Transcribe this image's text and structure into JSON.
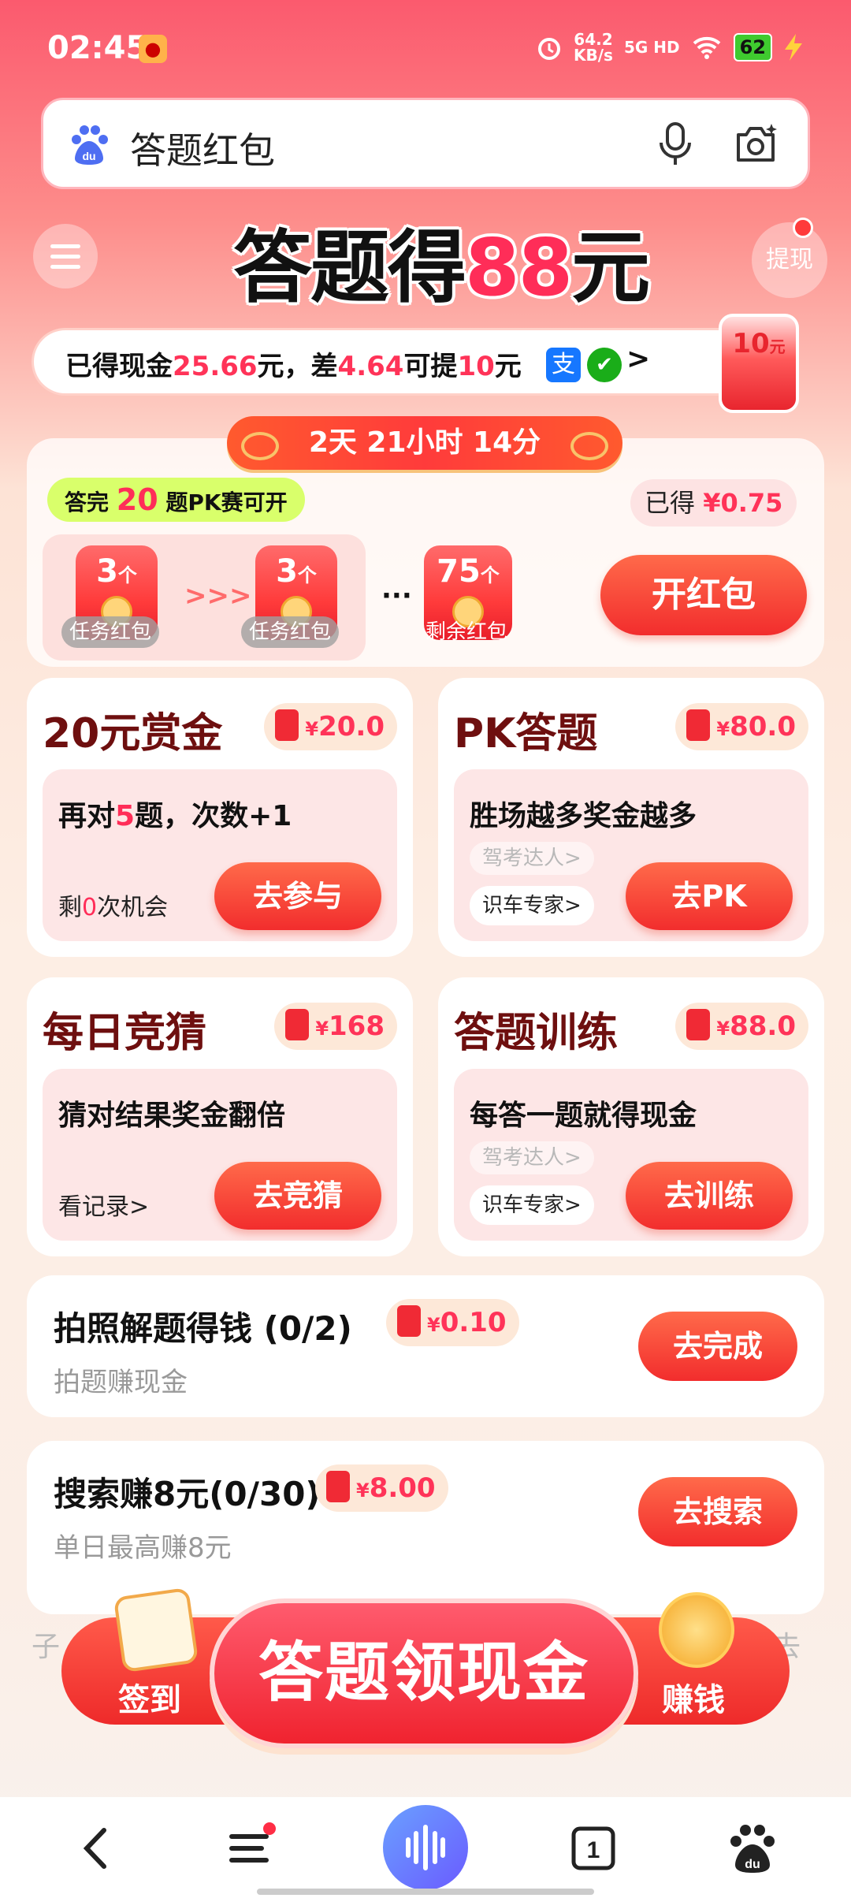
{
  "status": {
    "time": "02:45",
    "speed_value": "64.2",
    "speed_unit": "KB/s",
    "network": "5G HD",
    "battery": "62"
  },
  "search": {
    "query": "答题红包"
  },
  "header": {
    "headline_pre": "答题得",
    "headline_num": "88",
    "headline_post": "元",
    "withdraw": "提现"
  },
  "cash": {
    "t1": "已得现金",
    "v1": "25.66",
    "t2": "元，差",
    "v2": "4.64",
    "t3": "可提",
    "v3": "10",
    "t4": "元",
    "alipay": "支",
    "arrow": ">",
    "env_amount": "10",
    "env_unit": "元"
  },
  "countdown": "2天 21小时 14分",
  "pk_card": {
    "tag_pre": "答完",
    "tag_num": "20",
    "tag_post": "题PK赛可开",
    "earned_label": "已得",
    "earned_value": "¥0.75",
    "envelopes": [
      {
        "count": "3",
        "unit": "个",
        "label": "任务红包"
      },
      {
        "count": "3",
        "unit": "个",
        "label": "任务红包"
      },
      {
        "count": "75",
        "unit": "个",
        "label": "剩余红包"
      }
    ],
    "chev": ">>>",
    "dots": "···",
    "open_btn": "开红包"
  },
  "cards": [
    {
      "title": "20元赏金",
      "reward_y": "¥",
      "reward": "20.0",
      "desc_pre": "再对",
      "desc_num": "5",
      "desc_post": "题，次数+1",
      "sub_pre": "剩",
      "sub_num": "0",
      "sub_post": "次机会",
      "btn": "去参与"
    },
    {
      "title": "PK答题",
      "reward_y": "¥",
      "reward": "80.0",
      "desc": "胜场越多奖金越多",
      "ghost": "驾考达人>",
      "pill": "识车专家>",
      "btn": "去PK"
    },
    {
      "title": "每日竞猜",
      "reward_y": "¥",
      "reward": "168",
      "desc": "猜对结果奖金翻倍",
      "sub": "看记录>",
      "btn": "去竞猜"
    },
    {
      "title": "答题训练",
      "reward_y": "¥",
      "reward": "88.0",
      "desc": "每答一题就得现金",
      "ghost": "驾考达人>",
      "pill": "识车专家>",
      "btn": "去训练"
    }
  ],
  "tasks": [
    {
      "title": "拍照解题得钱 (0/2)",
      "reward_y": "¥",
      "reward": "0.10",
      "sub": "拍题赚现金",
      "btn": "去完成"
    },
    {
      "title": "搜索赚8元(0/30)",
      "reward_y": "¥",
      "reward": "8.00",
      "sub": "单日最高赚8元",
      "btn": "去搜索"
    }
  ],
  "bottom": {
    "sign": "签到",
    "cta": "答题领现金",
    "earn": "赚钱",
    "bg_left": "子",
    "bg_right": "去"
  },
  "nav": {
    "tab_count": "1"
  },
  "colors": {
    "accent": "#ff2d58",
    "button": "#f22d2d",
    "title": "#6e0f0f"
  }
}
